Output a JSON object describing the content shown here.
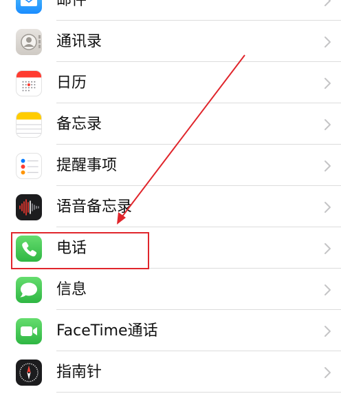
{
  "settings_list": {
    "items": [
      {
        "label": "邮件",
        "icon": "mail-icon"
      },
      {
        "label": "通讯录",
        "icon": "contacts-icon"
      },
      {
        "label": "日历",
        "icon": "calendar-icon"
      },
      {
        "label": "备忘录",
        "icon": "notes-icon"
      },
      {
        "label": "提醒事项",
        "icon": "reminders-icon"
      },
      {
        "label": "语音备忘录",
        "icon": "voice-memos-icon"
      },
      {
        "label": "电话",
        "icon": "phone-icon"
      },
      {
        "label": "信息",
        "icon": "messages-icon"
      },
      {
        "label": "FaceTime通话",
        "icon": "facetime-icon"
      },
      {
        "label": "指南针",
        "icon": "compass-icon"
      }
    ]
  },
  "colors": {
    "annotation_red": "#e0252b",
    "chevron": "#c4c4c6",
    "green": "#34c759",
    "mail_blue": "#1a8cff"
  }
}
